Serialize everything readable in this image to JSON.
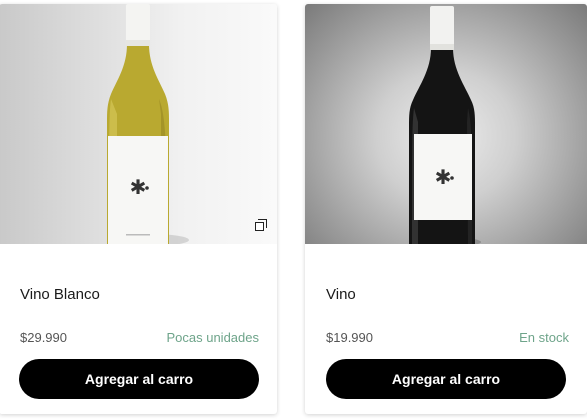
{
  "products": [
    {
      "name": "Vino Blanco",
      "price": "$29.990",
      "stock_status": "Pocas unidades",
      "button_label": "Agregar al carro",
      "stock_color": "#6ea48a"
    },
    {
      "name": "Vino",
      "price": "$19.990",
      "stock_status": "En stock",
      "button_label": "Agregar al carro",
      "stock_color": "#6ea48a"
    }
  ],
  "icons": {
    "gallery": "gallery-icon",
    "label_mark": "asterisk-dot-logo"
  },
  "colors": {
    "button_bg": "#000000",
    "button_text": "#ffffff"
  }
}
